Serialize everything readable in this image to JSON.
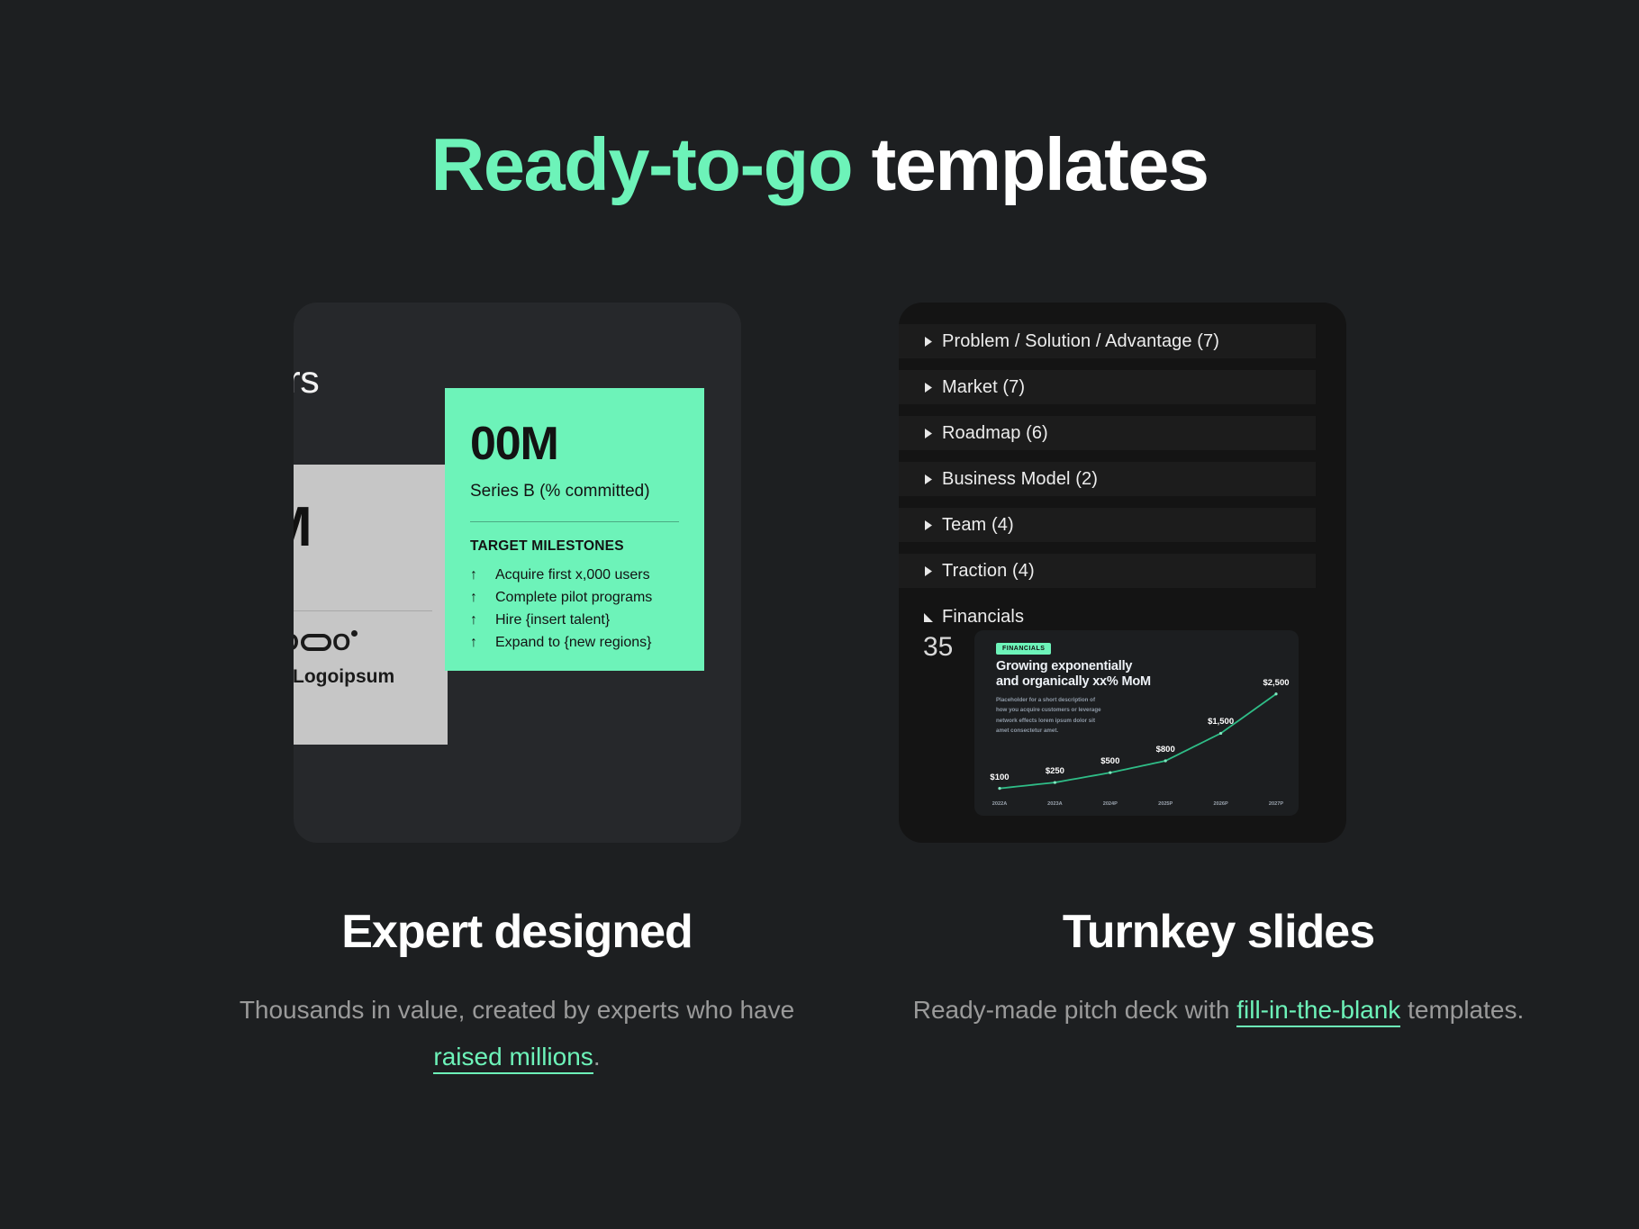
{
  "heading": {
    "accent_text": "Ready-to-go",
    "rest_text": " templates",
    "accent_color": "#6df3b9"
  },
  "left_card": {
    "slide_title": "ors",
    "grey_slide": {
      "big_value": "M",
      "sub_label": "#)",
      "logos": [
        {
          "name": "logo-wordmark",
          "text": "LO"
        },
        {
          "name": "logoipsum-wordmark",
          "text": "Logoipsum"
        }
      ]
    },
    "mint_panel": {
      "amount": "00M",
      "subtitle": "Series B (% committed)",
      "section_heading": "TARGET MILESTONES",
      "milestones": [
        "Acquire first x,000 users",
        "Complete pilot programs",
        "Hire {insert talent}",
        "Expand to {new regions}"
      ],
      "arrow_glyph": "↑",
      "background": "#6df3b9"
    }
  },
  "right_card": {
    "slide_sections": [
      {
        "label": "Problem / Solution / Advantage (7)",
        "expanded": false
      },
      {
        "label": "Market (7)",
        "expanded": false
      },
      {
        "label": "Roadmap (6)",
        "expanded": false
      },
      {
        "label": "Business Model (2)",
        "expanded": false
      },
      {
        "label": "Team (4)",
        "expanded": false
      },
      {
        "label": "Traction (4)",
        "expanded": false
      },
      {
        "label": "Financials",
        "expanded": true
      }
    ],
    "slide_number": "35",
    "thumbnail": {
      "badge": "FINANCIALS",
      "title_line_1": "Growing exponentially",
      "title_line_2": "and organically xx% MoM",
      "description": "Placeholder for a short description of how you acquire customers or leverage network effects lorem ipsum dolor sit amet consectetur amet."
    }
  },
  "chart_data": {
    "type": "line",
    "title": "Growing exponentially and organically xx% MoM",
    "xlabel": "",
    "ylabel": "",
    "grid": false,
    "legend": false,
    "line_color": "#2fbd87",
    "x": [
      "2022A",
      "2023A",
      "2024P",
      "2025P",
      "2026P",
      "2027P"
    ],
    "categories": [
      "2022A",
      "2023A",
      "2024P",
      "2025P",
      "2026P",
      "2027P"
    ],
    "values": [
      100,
      250,
      500,
      800,
      1500,
      2500
    ],
    "point_labels": [
      "$100",
      "$250",
      "$500",
      "$800",
      "$1,500",
      "$2,500"
    ],
    "ylim": [
      0,
      2700
    ]
  },
  "captions": {
    "left": {
      "title": "Expert designed",
      "body_before": "Thousands in value, created by experts who have ",
      "link": "raised millions",
      "body_after": "."
    },
    "right": {
      "title": "Turnkey slides",
      "body_before": "Ready-made pitch deck with ",
      "link": "fill-in-the-blank",
      "body_after": " templates."
    }
  }
}
